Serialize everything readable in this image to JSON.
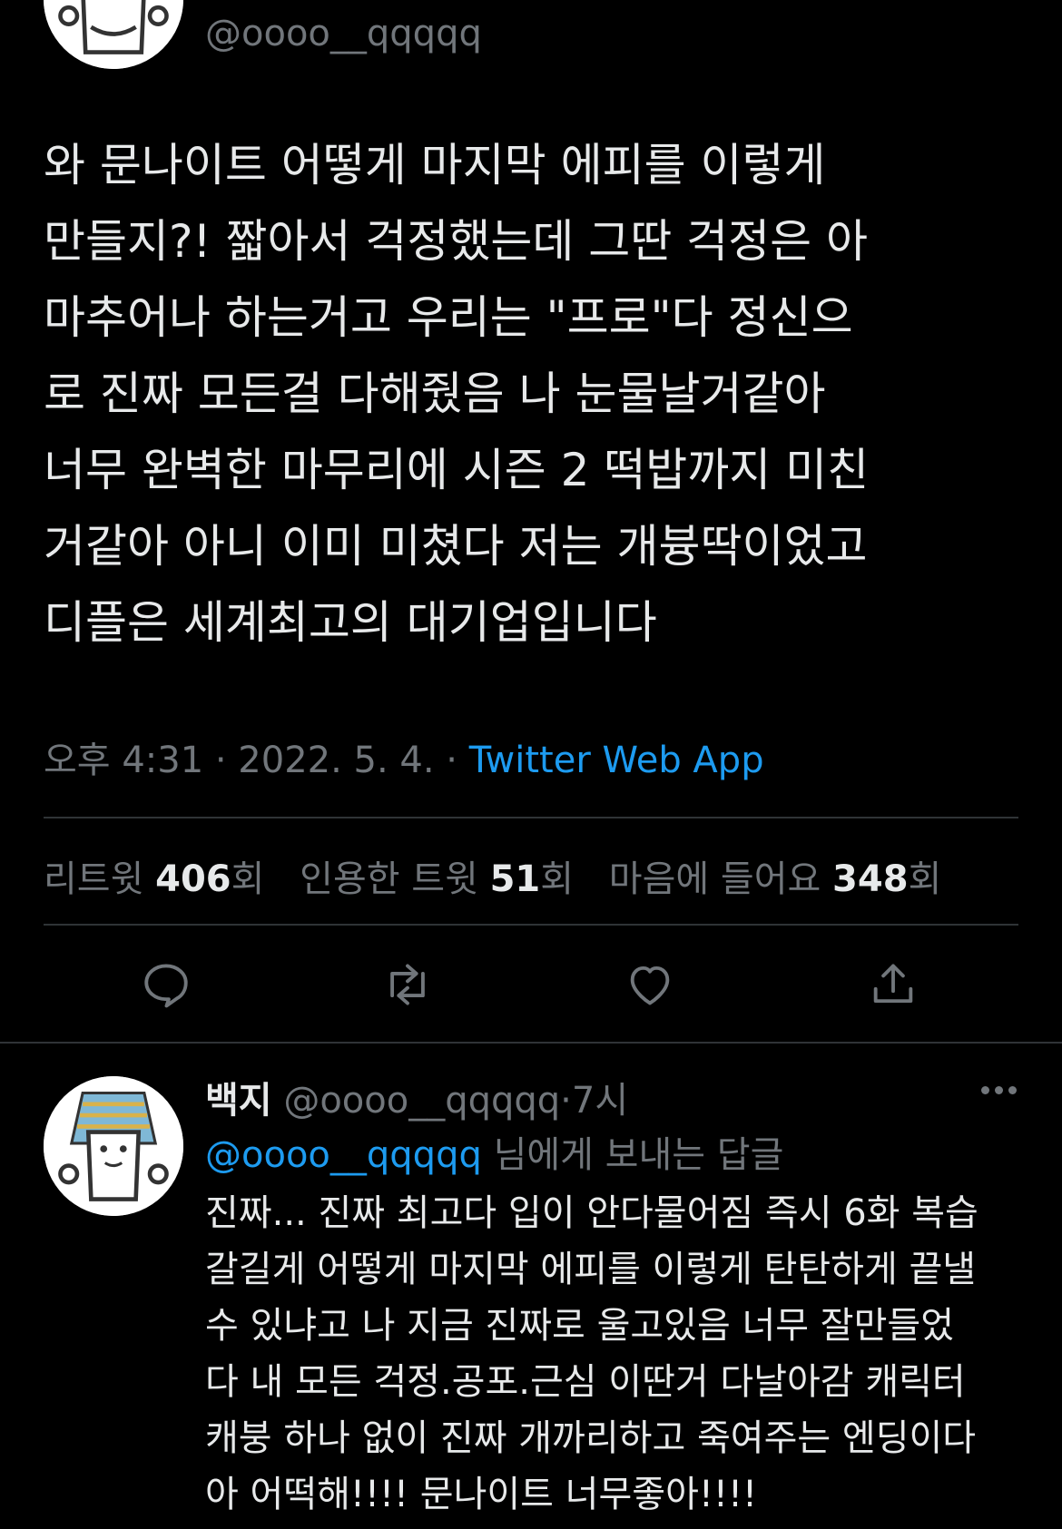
{
  "main_tweet": {
    "handle": "@oooo__qqqqq",
    "text": "와 문나이트 어떻게 마지막 에피를 이렇게\n만들지?! 짧아서 걱정했는데 그딴 걱정은 아\n마추어나 하는거고 우리는 \"프로\"다 정신으\n로 진짜 모든걸 다해줬음 나 눈물날거같아\n너무 완벽한 마무리에 시즌 2 떡밥까지 미친\n거같아 아니 이미 미쳤다 저는 개븅딱이었고\n디플은 세계최고의 대기업입니다",
    "time": "오후 4:31",
    "date": "2022. 5. 4.",
    "separator": "·",
    "source": "Twitter Web App",
    "stats": {
      "retweets_label": "리트윗",
      "retweets_count": "406",
      "quotes_label": "인용한 트윗",
      "quotes_count": "51",
      "likes_label": "마음에 들어요",
      "likes_count": "348",
      "unit": "회"
    },
    "actions": {
      "reply_icon": "reply-icon",
      "retweet_icon": "retweet-icon",
      "like_icon": "heart-icon",
      "share_icon": "share-icon"
    }
  },
  "reply_tweet": {
    "name": "백지",
    "handle": "@oooo__qqqqq",
    "separator": "·",
    "time": "7시",
    "replying_to_handle": "@oooo__qqqqq",
    "replying_to_suffix": "님에게 보내는 답글",
    "text": "진짜... 진짜 최고다 입이 안다물어짐 즉시 6화 복습\n갈길게 어떻게 마지막 에피를 이렇게 탄탄하게 끝낼\n수 있냐고 나 지금 진짜로 울고있음 너무 잘만들었\n다 내 모든 걱정.공포.근심 이딴거 다날아감 캐릭터\n캐붕 하나 없이 진짜 개까리하고 죽여주는 엔딩이다\n아 어떡해!!!! 문나이트 너무좋아!!!!"
  },
  "colors": {
    "background": "#000000",
    "text": "#e7e9ea",
    "muted": "#71767b",
    "accent": "#1d9bf0",
    "divider": "#2f3336"
  }
}
